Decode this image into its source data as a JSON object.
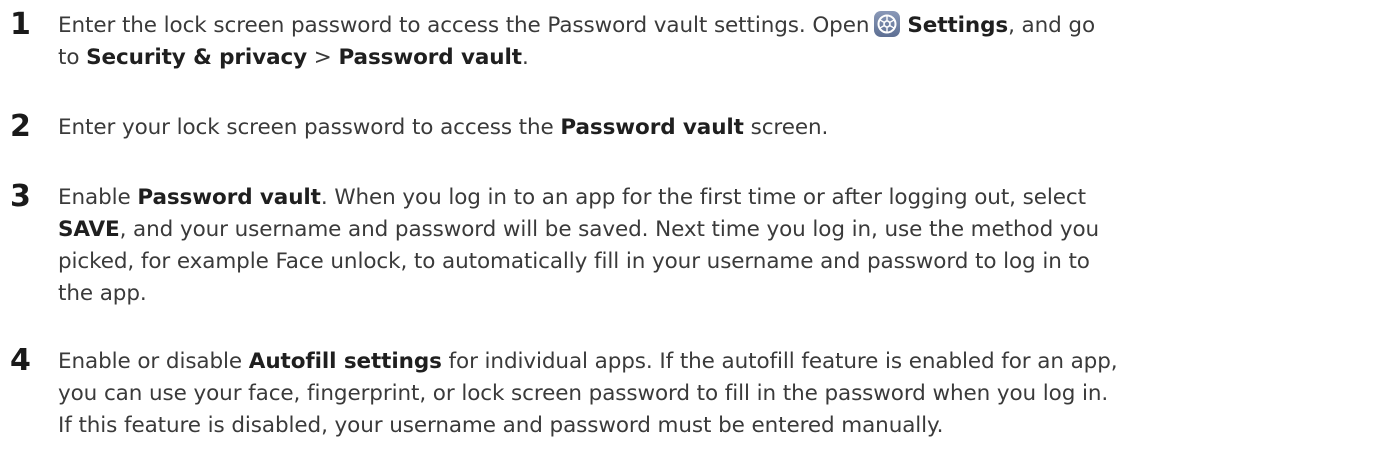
{
  "steps": [
    {
      "number": "1",
      "line1": {
        "t1": "Enter the lock screen password to access the Password vault settings. Open",
        "b1": "Settings",
        "t2": ", and go"
      },
      "line2": {
        "t1": "to ",
        "b1": "Security & privacy",
        "t2": " > ",
        "b2": "Password vault",
        "t3": "."
      },
      "icon": "settings-gear-icon"
    },
    {
      "number": "2",
      "line1": {
        "t1": "Enter your lock screen password to access the ",
        "b1": "Password vault",
        "t2": " screen."
      }
    },
    {
      "number": "3",
      "line1": {
        "t1": "Enable ",
        "b1": "Password vault",
        "t2": ". When you log in to an app for the first time or after logging out, select"
      },
      "line2": {
        "b1": "SAVE",
        "t1": ", and your username and password will be saved. Next time you log in, use the method you"
      },
      "line3": "picked, for example Face unlock, to automatically fill in your username and password to log in to",
      "line4": "the app."
    },
    {
      "number": "4",
      "line1": {
        "t1": "Enable or disable ",
        "b1": "Autofill settings",
        "t2": " for individual apps. If the autofill feature is enabled for an app,"
      },
      "line2": "you can use your face, fingerprint, or lock screen password to fill in the password when you log in.",
      "line3": "If this feature is disabled, your username and password must be entered manually."
    }
  ]
}
